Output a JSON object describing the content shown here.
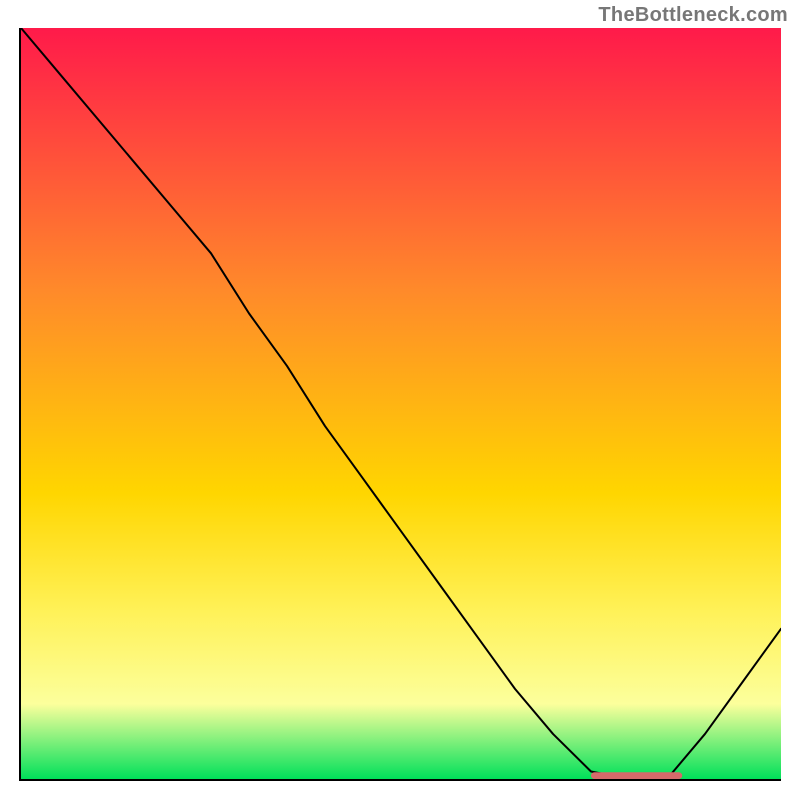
{
  "watermark": "TheBottleneck.com",
  "colors": {
    "grad_top": "#ff1a4a",
    "grad_mid1": "#ff8a2a",
    "grad_mid2": "#ffd600",
    "grad_mid3": "#fff25a",
    "grad_mid4": "#fcff9c",
    "grad_bottom": "#00e05a",
    "line": "#000000",
    "marker": "#d46a6a"
  },
  "chart_data": {
    "type": "line",
    "title": "",
    "xlabel": "",
    "ylabel": "",
    "xlim": [
      0,
      100
    ],
    "ylim": [
      0,
      100
    ],
    "series": [
      {
        "name": "curve",
        "x": [
          0,
          5,
          10,
          15,
          20,
          25,
          30,
          35,
          40,
          45,
          50,
          55,
          60,
          65,
          70,
          75,
          80,
          85,
          90,
          95,
          100
        ],
        "y": [
          100,
          94,
          88,
          82,
          76,
          70,
          62,
          55,
          47,
          40,
          33,
          26,
          19,
          12,
          6,
          1,
          0,
          0,
          6,
          13,
          20
        ]
      }
    ],
    "marker": {
      "x_start": 75,
      "x_end": 87,
      "y": 0
    }
  }
}
